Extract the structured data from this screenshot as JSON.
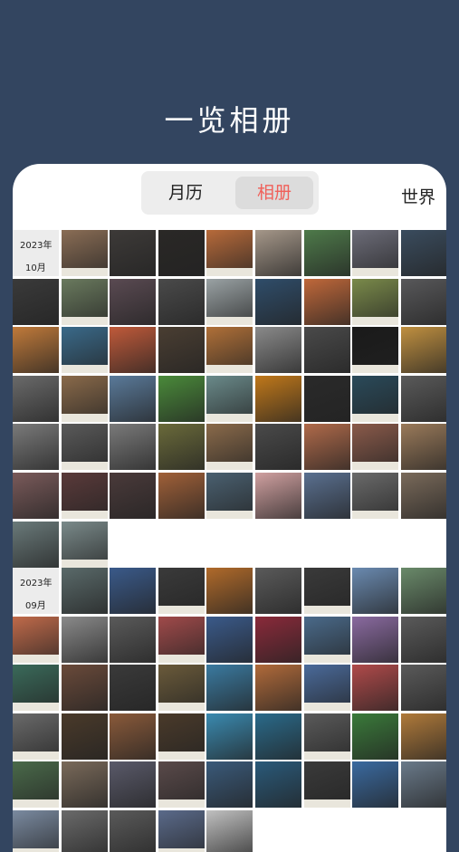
{
  "header": {
    "title": "一览相册"
  },
  "segmented": {
    "calendar_label": "月历",
    "album_label": "相册",
    "active": "album"
  },
  "world_label": "世界",
  "sections": [
    {
      "year": "2023年",
      "month": "10月",
      "cells": [
        "#8a6d55",
        "#3d3a38",
        "#2a2826",
        "#b76a3a",
        "#a59789",
        "#4e7a4a",
        "#6c6c78",
        "#3a4c5e",
        "#3a3a3a",
        "#6a7a5e",
        "#5a4a52",
        "#4a4a4a",
        "#9aa2a4",
        "#2f4d6a",
        "#c0683a",
        "#7a8a4a",
        "#58585a",
        "#c07a3a",
        "#3a6a8a",
        "#c05a3a",
        "#4a3e32",
        "#b07038",
        "#8a8a8a",
        "#4a4a4a",
        "#1a1a1a",
        "#c09040",
        "#6a6a6a",
        "#8a6a4a",
        "#5a7a9a",
        "#4a8a3a",
        "#6a8a8a",
        "#c0781a",
        "#2a2a2a",
        "#2a4a5a",
        "#5a5a5a",
        "#7a7a7a",
        "#5a5a5a",
        "#7a7a7a",
        "#6a6a3a",
        "#8a6a4a",
        "#4a4a4a",
        "#b06a4a",
        "#8a5a4a",
        "#9a7a5a",
        "#7a5a5a",
        "#5a3a3a",
        "#4a3a3a",
        "#a06038",
        "#4a6070",
        "#d0a0a0",
        "#5a7090",
        "#6a6a6a",
        "#7a6a5a",
        "#6a7a7a",
        "#7a8a8a"
      ]
    },
    {
      "year": "2023年",
      "month": "09月",
      "cells": [
        "#5a6a6a",
        "#3a5a8a",
        "#3a3a3a",
        "#b06a2a",
        "#5a5a5a",
        "#3a3a3a",
        "#6a8ab0",
        "#6a8a6a",
        "#c06a4a",
        "#8a8a8a",
        "#5a5a5a",
        "#a04a4a",
        "#3a5a8a",
        "#8a2a3a",
        "#4a6a8a",
        "#8a6aa0",
        "#5a5a5a",
        "#3a6a5a",
        "#6a4a3a",
        "#3a3a3a",
        "#6a5a3a",
        "#3a7aa0",
        "#b06a3a",
        "#4a6a9a",
        "#b04a4a",
        "#5a5a5a",
        "#6a6a6a",
        "#4a3a2a",
        "#8a5a3a",
        "#4a3a2a",
        "#3a8ab0",
        "#2a6a8a",
        "#5a5a5a",
        "#3a7a3a",
        "#b07a3a",
        "#4a6a4a",
        "#7a6a5a",
        "#5a5a6a",
        "#5a4a4a",
        "#3a5a7a",
        "#2a5a7a",
        "#3a3a3a",
        "#3a6aa0",
        "#6a7a8a",
        "#7a8aa0",
        "#6a6a6a",
        "#5a5a5a",
        "#5a6a8a",
        "#c0c0c0"
      ]
    }
  ]
}
